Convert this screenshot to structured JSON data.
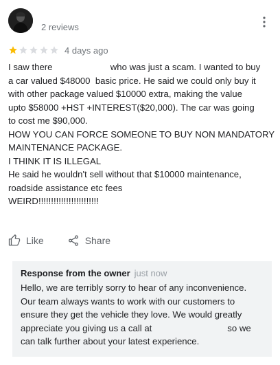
{
  "reviewer": {
    "avatar_icon": "user-avatar-icon",
    "review_count": "2 reviews"
  },
  "menu": {
    "icon": "more-vert-icon"
  },
  "rating": {
    "value": 1,
    "max": 5,
    "filled_color": "#fbbc04",
    "empty_color": "#dadce0"
  },
  "date": "4 days ago",
  "review": {
    "text": "I saw there                       who was just a scam. I wanted to buy\na car valued $48000  basic price. He said we could only buy it\nwith other package valued $10000 extra, making the value\nupto $58000 +HST +INTEREST($20,000). The car was going\nto cost me $90,000.\nHOW YOU CAN FORCE SOMEONE TO BUY NON MANDATORY\nMAINTENANCE PACKAGE.\nI THINK IT IS ILLEGAL\nHe said he wouldn't sell without that $10000 maintenance,\nroadside assistance etc fees\nWEIRD!!!!!!!!!!!!!!!!!!!!!!!!"
  },
  "actions": {
    "like_label": "Like",
    "share_label": "Share"
  },
  "owner_response": {
    "title": "Response from the owner",
    "time": "just now",
    "text": "Hello, we are terribly sorry to hear of any inconvenience.\nOur team always wants to work with our customers to\nensure they get the vehicle they love. We would greatly\nappreciate you giving us a call at                              so we\ncan talk further about your latest experience."
  }
}
